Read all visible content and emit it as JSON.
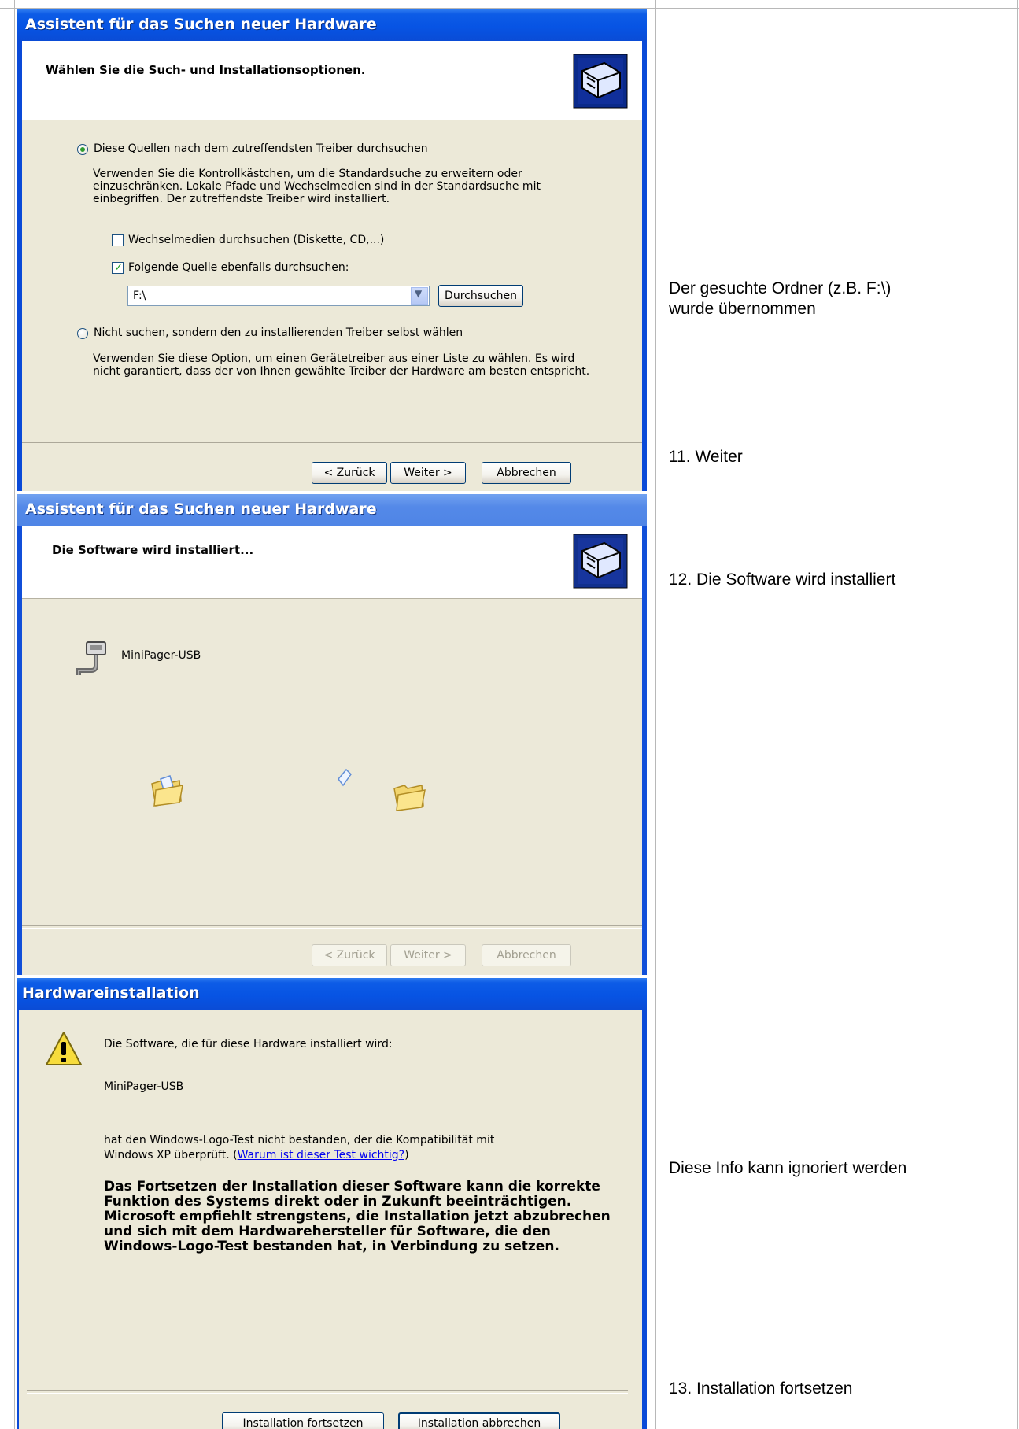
{
  "dialog1": {
    "title": "Assistent für das Suchen neuer Hardware",
    "header": "Wählen Sie die Such- und Installationsoptionen.",
    "option_search_label": "Diese Quellen nach dem zutreffendsten Treiber durchsuchen",
    "option_search_selected": true,
    "option_search_desc": "Verwenden Sie die Kontrollkästchen, um die Standardsuche zu erweitern oder\neinzuschränken. Lokale Pfade und Wechselmedien sind in der Standardsuche mit\neinbegriffen. Der zutreffendste Treiber wird installiert.",
    "chk_removable_label": "Wechselmedien durchsuchen (Diskette, CD,...)",
    "chk_removable_checked": false,
    "chk_location_label": "Folgende Quelle ebenfalls durchsuchen:",
    "chk_location_checked": true,
    "path_value": "F:\\",
    "browse_label": "Durchsuchen",
    "option_manual_label": "Nicht suchen, sondern den zu installierenden Treiber selbst wählen",
    "option_manual_desc": "Verwenden Sie diese Option, um einen Gerätetreiber aus einer Liste zu wählen. Es wird\nnicht garantiert, dass der von Ihnen gewählte Treiber der Hardware am besten entspricht.",
    "back_label": "< Zurück",
    "next_label": "Weiter >",
    "cancel_label": "Abbrechen"
  },
  "dialog2": {
    "title": "Assistent für das Suchen neuer Hardware",
    "header": "Die Software wird installiert...",
    "device_name": "MiniPager-USB",
    "back_label": "< Zurück",
    "next_label": "Weiter >",
    "cancel_label": "Abbrechen"
  },
  "dialog3": {
    "title": "Hardwareinstallation",
    "line1": "Die Software, die für diese Hardware installiert wird:",
    "device_name": "MiniPager-USB",
    "line2a": "hat den Windows-Logo-Test nicht bestanden, der die Kompatibilität mit",
    "line2b": "Windows XP überprüft. (",
    "link": "Warum ist dieser Test wichtig?",
    "line2c": ")",
    "warning": "Das Fortsetzen der Installation dieser Software kann die korrekte\nFunktion des Systems direkt oder in Zukunft beeinträchtigen.\nMicrosoft empfiehlt strengstens, die Installation jetzt abzubrechen\nund sich mit dem Hardwarehersteller für Software, die den\nWindows-Logo-Test bestanden hat, in Verbindung zu setzen.",
    "continue_label": "Installation fortsetzen",
    "abort_label": "Installation abbrechen"
  },
  "notes": {
    "folder_note": "Der gesuchte Ordner (z.B. F:\\)\nwurde übernommen",
    "step11": "11. Weiter",
    "step12": "12. Die Software wird installiert",
    "info_note": "Diese Info kann ignoriert werden",
    "step13": "13. Installation fortsetzen"
  }
}
